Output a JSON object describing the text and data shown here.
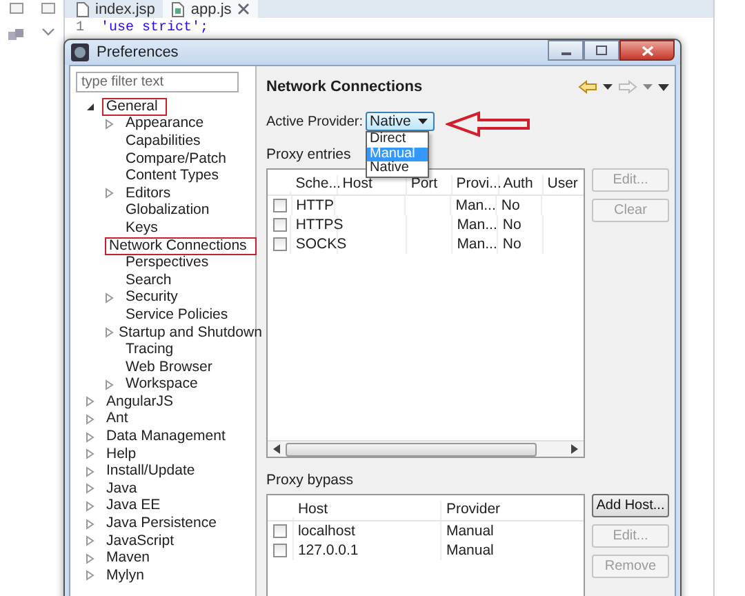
{
  "editor": {
    "tabs": [
      {
        "label": "index.jsp",
        "selected": false,
        "closable": false
      },
      {
        "label": "app.js",
        "selected": true,
        "closable": true
      }
    ],
    "lines": [
      {
        "number": "1",
        "text": "'use strict';"
      }
    ]
  },
  "dialog": {
    "title": "Preferences",
    "filter": {
      "placeholder": "type filter text"
    },
    "tree": [
      {
        "label": "General",
        "expanded": true,
        "annotated": true,
        "children": [
          {
            "label": "Appearance",
            "expanded": false,
            "annotated": false
          },
          {
            "label": "Capabilities",
            "annotated": false
          },
          {
            "label": "Compare/Patch",
            "annotated": false
          },
          {
            "label": "Content Types",
            "annotated": false
          },
          {
            "label": "Editors",
            "expanded": false,
            "annotated": false
          },
          {
            "label": "Globalization",
            "annotated": false
          },
          {
            "label": "Keys",
            "annotated": false
          },
          {
            "label": "Network Connections",
            "annotated": true
          },
          {
            "label": "Perspectives",
            "annotated": false
          },
          {
            "label": "Search",
            "annotated": false
          },
          {
            "label": "Security",
            "expanded": false,
            "annotated": false
          },
          {
            "label": "Service Policies",
            "annotated": false
          },
          {
            "label": "Startup and Shutdown",
            "expanded": false,
            "annotated": false
          },
          {
            "label": "Tracing",
            "annotated": false
          },
          {
            "label": "Web Browser",
            "annotated": false
          },
          {
            "label": "Workspace",
            "expanded": false,
            "annotated": false
          }
        ]
      },
      {
        "label": "AngularJS",
        "expanded": false,
        "annotated": false
      },
      {
        "label": "Ant",
        "expanded": false,
        "annotated": false
      },
      {
        "label": "Data Management",
        "expanded": false,
        "annotated": false
      },
      {
        "label": "Help",
        "expanded": false,
        "annotated": false
      },
      {
        "label": "Install/Update",
        "expanded": false,
        "annotated": false
      },
      {
        "label": "Java",
        "expanded": false,
        "annotated": false
      },
      {
        "label": "Java EE",
        "expanded": false,
        "annotated": false
      },
      {
        "label": "Java Persistence",
        "expanded": false,
        "annotated": false
      },
      {
        "label": "JavaScript",
        "expanded": false,
        "annotated": false
      },
      {
        "label": "Maven",
        "expanded": false,
        "annotated": false
      },
      {
        "label": "Mylyn",
        "expanded": false,
        "annotated": false
      }
    ],
    "page": {
      "title": "Network Connections",
      "provider": {
        "label": "Active Provider:",
        "value": "Native",
        "options": [
          {
            "label": "Direct",
            "highlighted": false
          },
          {
            "label": "Manual",
            "highlighted": true
          },
          {
            "label": "Native",
            "highlighted": false
          }
        ],
        "arrow_annotation": true
      },
      "entries": {
        "label": "Proxy entries",
        "columns": [
          "Sche...",
          "Host",
          "Port",
          "Provi...",
          "Auth",
          "User"
        ],
        "rows": [
          {
            "checked": false,
            "cells": [
              "HTTP",
              "",
              "",
              "Man...",
              "No",
              ""
            ]
          },
          {
            "checked": false,
            "cells": [
              "HTTPS",
              "",
              "",
              "Man...",
              "No",
              ""
            ]
          },
          {
            "checked": false,
            "cells": [
              "SOCKS",
              "",
              "",
              "Man...",
              "No",
              ""
            ]
          }
        ],
        "buttons": [
          {
            "label": "Edit...",
            "disabled": true
          },
          {
            "label": "Clear",
            "disabled": true
          }
        ]
      },
      "bypass": {
        "label": "Proxy bypass",
        "columns": [
          "Host",
          "Provider"
        ],
        "rows": [
          {
            "checked": false,
            "cells": [
              "localhost",
              "Manual"
            ]
          },
          {
            "checked": false,
            "cells": [
              "127.0.0.1",
              "Manual"
            ]
          }
        ],
        "buttons": [
          {
            "label": "Add Host...",
            "disabled": false
          },
          {
            "label": "Edit...",
            "disabled": true
          },
          {
            "label": "Remove",
            "disabled": true
          }
        ]
      }
    }
  }
}
